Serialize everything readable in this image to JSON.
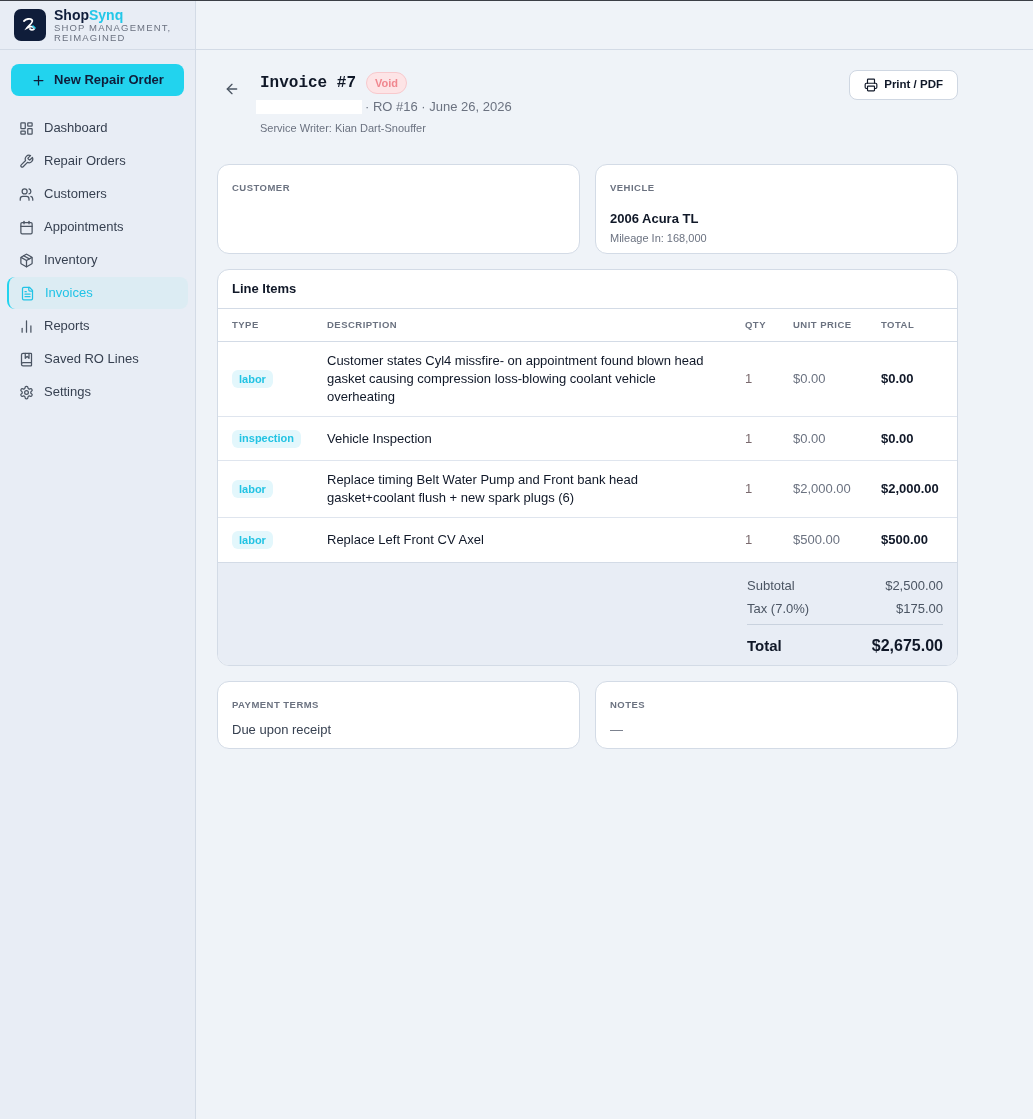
{
  "sidebar": {
    "brand": {
      "name": "Shop",
      "accent": "Synq",
      "tagline": "SHOP MANAGEMENT, REIMAGINED"
    },
    "new_button": {
      "label": "New Repair Order"
    },
    "items": [
      {
        "label": "Dashboard",
        "selected": false
      },
      {
        "label": "Repair Orders",
        "selected": false
      },
      {
        "label": "Customers",
        "selected": false
      },
      {
        "label": "Appointments",
        "selected": false
      },
      {
        "label": "Inventory",
        "selected": false
      },
      {
        "label": "Invoices",
        "selected": true
      },
      {
        "label": "Reports",
        "selected": false
      },
      {
        "label": "Saved RO Lines",
        "selected": false
      },
      {
        "label": "Settings",
        "selected": false
      }
    ]
  },
  "invoice_header": {
    "title": "Invoice #7",
    "status": {
      "label": "Void",
      "kind": "void"
    },
    "meta": "· RO #16 · June 26, 2026",
    "service_writer": "Service Writer: Kian Dart-Snouffer",
    "print_button": {
      "label": "Print / PDF"
    }
  },
  "customer_card": {
    "label": "CUSTOMER"
  },
  "vehicle_card": {
    "label": "VEHICLE",
    "name": "2006 Acura TL",
    "mileage": "Mileage In: 168,000"
  },
  "line_items": {
    "title": "Line Items",
    "columns": [
      "TYPE",
      "DESCRIPTION",
      "QTY",
      "UNIT PRICE",
      "TOTAL"
    ],
    "rows": [
      {
        "type": "labor",
        "description": "Customer states Cyl4 missfire- on appointment found blown head gasket causing compression loss-blowing coolant vehicle overheating",
        "qty": "1",
        "unit_price": "$0.00",
        "total": "$0.00"
      },
      {
        "type": "inspection",
        "description": "Vehicle Inspection",
        "qty": "1",
        "unit_price": "$0.00",
        "total": "$0.00"
      },
      {
        "type": "labor",
        "description": "Replace timing Belt Water Pump and Front bank head gasket+coolant flush + new spark plugs (6)",
        "qty": "1",
        "unit_price": "$2,000.00",
        "total": "$2,000.00"
      },
      {
        "type": "labor",
        "description": "Replace Left Front CV Axel",
        "qty": "1",
        "unit_price": "$500.00",
        "total": "$500.00"
      }
    ]
  },
  "totals": [
    {
      "kind": "subtotal",
      "label": "Subtotal",
      "value": "$2,500.00"
    },
    {
      "kind": "tax",
      "label": "Tax (7.0%)",
      "value": "$175.00"
    },
    {
      "kind": "grand",
      "label": "Total",
      "value": "$2,675.00"
    }
  ],
  "payment_terms": {
    "label": "PAYMENT TERMS",
    "value": "Due upon receipt"
  },
  "notes": {
    "label": "NOTES",
    "value": "—"
  }
}
